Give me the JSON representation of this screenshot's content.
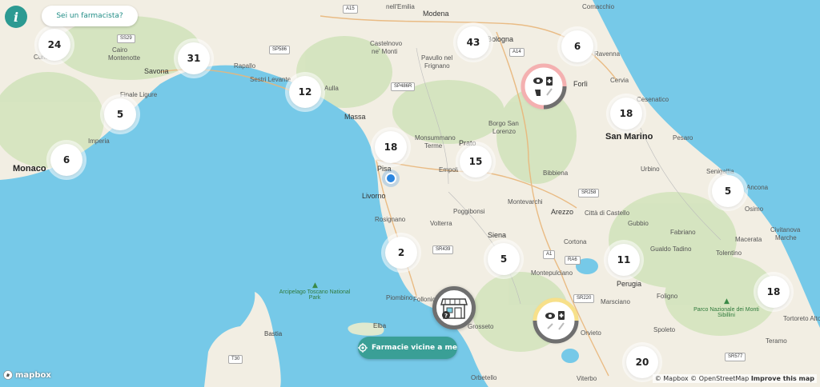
{
  "ui": {
    "info_button": "i",
    "pharmacist_button": "Sei un farmacista?",
    "nearby_button": "Farmacie vicine a me",
    "mapbox_logo": "mapbox",
    "attribution": {
      "mapbox": "© Mapbox",
      "osm": "© OpenStreetMap",
      "improve": "Improve this map"
    }
  },
  "clusters": [
    "24",
    "31",
    "5",
    "6",
    "12",
    "43",
    "18",
    "15",
    "6",
    "18",
    "5",
    "2",
    "5",
    "11",
    "18",
    "20"
  ],
  "labels": {
    "monaco": "Monaco",
    "san_marino": "San Marino",
    "cities": [
      "Modena",
      "nell'Emilia",
      "Castelnovo",
      "ne' Monti",
      "Pavullo nel",
      "Frignano",
      "Bologna",
      "Forlì",
      "Cervia",
      "Comacchio",
      "Ravenna",
      "Cesenatico",
      "Rapallo",
      "Sestri Levante",
      "Savona",
      "Finale Ligure",
      "Imperia",
      "Cairo",
      "Montenotte",
      "Cuneo",
      "Aulla",
      "Massa",
      "Monsummano",
      "Terme",
      "Prato",
      "Borgo San",
      "Lorenzo",
      "Pisa",
      "Empoli",
      "Livorno",
      "Bibbiena",
      "Montevarchi",
      "Arezzo",
      "Città di Castello",
      "Urbino",
      "Pesaro",
      "Senigallia",
      "Ancona",
      "Osimo",
      "Civitanova",
      "Marche",
      "Macerata",
      "Fabriano",
      "Gubbio",
      "Gualdo Tadino",
      "Tolentino",
      "Poggibonsi",
      "Volterra",
      "Siena",
      "Cortona",
      "Montepulciano",
      "Perugia",
      "Marsciano",
      "Foligno",
      "Spoleto",
      "Orvieto",
      "Viterbo",
      "Orbetello",
      "Grosseto",
      "Follonica",
      "Piombino",
      "Rosignano",
      "Bastia",
      "Elba",
      "Teramo",
      "Tortoreto Alto"
    ],
    "parks": [
      "Arcipelago Toscano National Park",
      "Parco Nazionale dei Monti Sibillini"
    ],
    "roads": [
      "A15",
      "SS29",
      "SP586",
      "A14",
      "SP486R",
      "SR258",
      "A1",
      "SR439",
      "RA6",
      "SR220",
      "T30",
      "SR577"
    ]
  }
}
